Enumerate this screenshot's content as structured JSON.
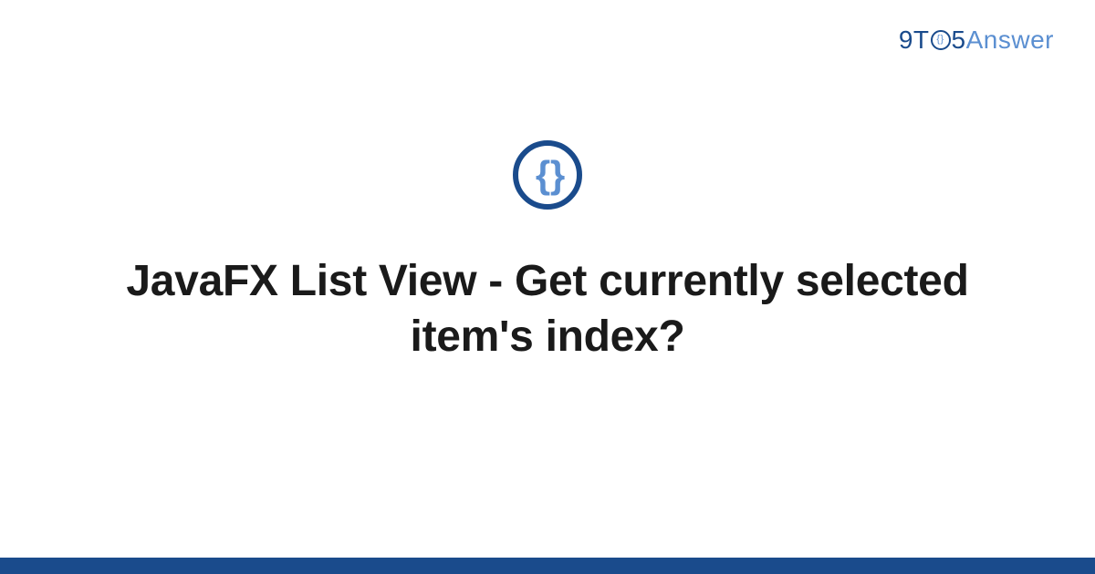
{
  "logo": {
    "part1": "9T",
    "circle_inner": "{}",
    "part2": "5",
    "part3": "Answer"
  },
  "topic_icon": {
    "glyph": "{ }",
    "name": "code-braces-icon"
  },
  "title": "JavaFX List View - Get currently selected item's index?",
  "colors": {
    "brand_dark": "#1a4b8c",
    "brand_light": "#5b8fd1"
  }
}
